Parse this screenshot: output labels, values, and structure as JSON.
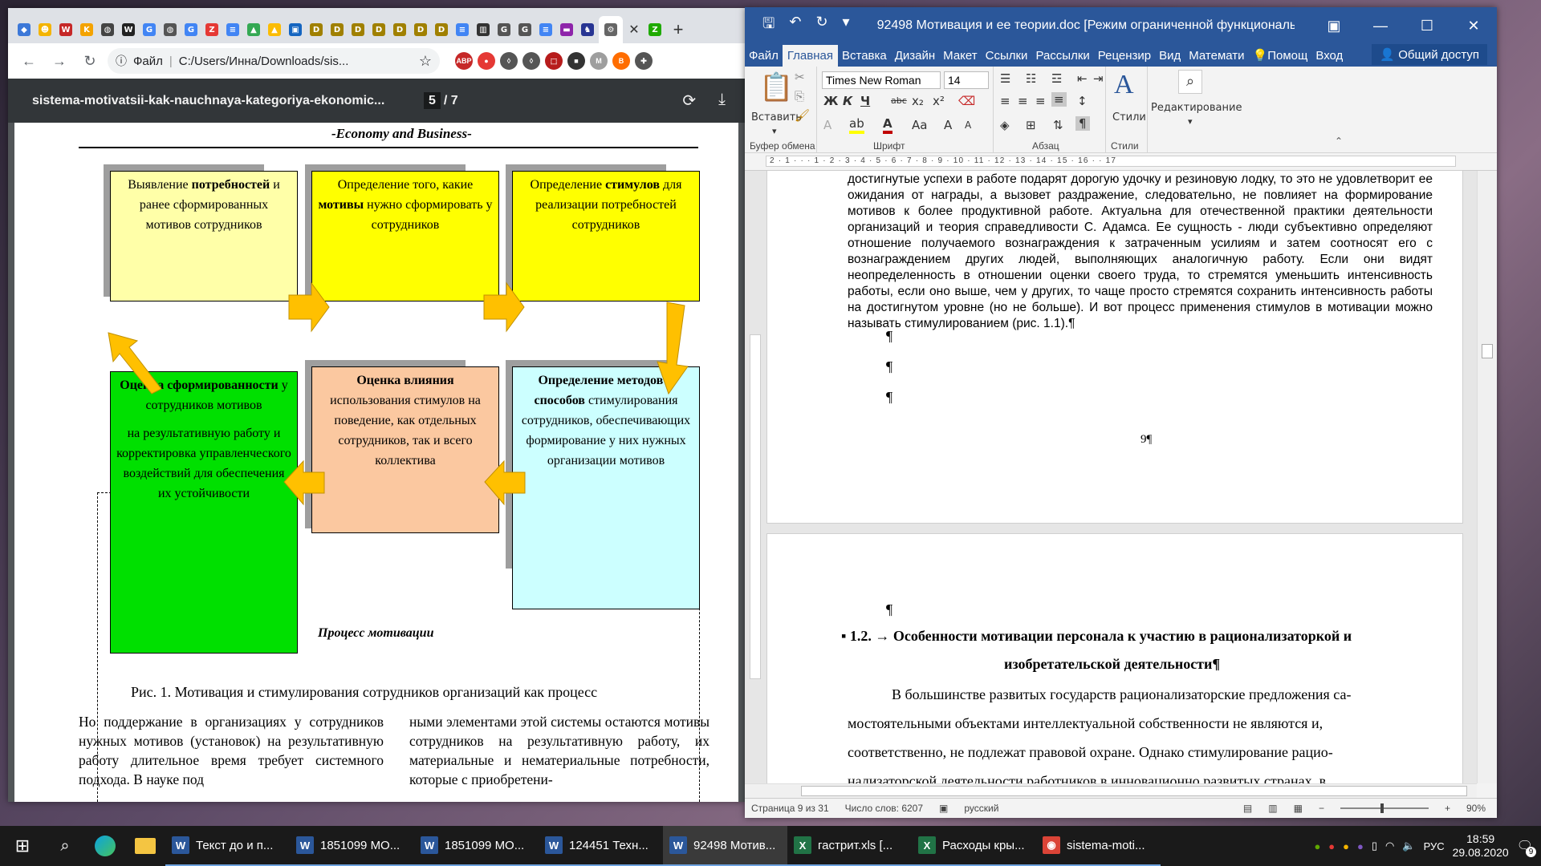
{
  "chrome": {
    "tabs": [
      {
        "icon": "diamond-icon",
        "color": "#3c78d8",
        "glyph": "◆"
      },
      {
        "icon": "face-icon",
        "color": "#f4b400",
        "glyph": "☻"
      },
      {
        "icon": "w-red-icon",
        "color": "#c62828",
        "glyph": "W"
      },
      {
        "icon": "k-icon",
        "color": "#f4a300",
        "glyph": "K"
      },
      {
        "icon": "globe-icon",
        "color": "#444",
        "glyph": "◍"
      },
      {
        "icon": "w-icon",
        "color": "#222",
        "glyph": "W"
      },
      {
        "icon": "g-icon",
        "color": "#4285f4",
        "glyph": "G"
      },
      {
        "icon": "globe2-icon",
        "color": "#555",
        "glyph": "◍"
      },
      {
        "icon": "g2-icon",
        "color": "#4285f4",
        "glyph": "G"
      },
      {
        "icon": "za-icon",
        "color": "#e53935",
        "glyph": "Z"
      },
      {
        "icon": "doc-icon",
        "color": "#4285f4",
        "glyph": "≡"
      },
      {
        "icon": "drive-icon",
        "color": "#34a853",
        "glyph": "▲"
      },
      {
        "icon": "drive2-icon",
        "color": "#fbbc04",
        "glyph": "▲"
      },
      {
        "icon": "photo-icon",
        "color": "#1565c0",
        "glyph": "▣"
      },
      {
        "icon": "d1-icon",
        "color": "#a08000",
        "glyph": "D"
      },
      {
        "icon": "d2-icon",
        "color": "#a08000",
        "glyph": "D"
      },
      {
        "icon": "d3-icon",
        "color": "#a08000",
        "glyph": "D"
      },
      {
        "icon": "d4-icon",
        "color": "#a08000",
        "glyph": "D"
      },
      {
        "icon": "d5-icon",
        "color": "#a08000",
        "glyph": "D"
      },
      {
        "icon": "d6-icon",
        "color": "#a08000",
        "glyph": "D"
      },
      {
        "icon": "d7-icon",
        "color": "#a08000",
        "glyph": "D"
      },
      {
        "icon": "doc2-icon",
        "color": "#4285f4",
        "glyph": "≡"
      },
      {
        "icon": "reader-icon",
        "color": "#333",
        "glyph": "▥"
      },
      {
        "icon": "gc-icon",
        "color": "#555",
        "glyph": "G"
      },
      {
        "icon": "gc2-icon",
        "color": "#555",
        "glyph": "G"
      },
      {
        "icon": "doc3-icon",
        "color": "#4285f4",
        "glyph": "≡"
      },
      {
        "icon": "flag-icon",
        "color": "#8e24aa",
        "glyph": "▬"
      },
      {
        "icon": "person-icon",
        "color": "#283593",
        "glyph": "♞"
      }
    ],
    "active_tab_icon": "gear-icon",
    "url_label": "Файл",
    "url": "C:/Users/Инна/Downloads/sis...",
    "extensions": [
      {
        "name": "abp-icon",
        "label": "ABP",
        "color": "#c62828"
      },
      {
        "name": "shield-red-icon",
        "label": "●",
        "color": "#e53935"
      },
      {
        "name": "shield-outline-icon",
        "label": "◊",
        "color": "#555"
      },
      {
        "name": "shield-outline2-icon",
        "label": "◊",
        "color": "#555"
      },
      {
        "name": "pdf-icon",
        "label": "⬚",
        "color": "#b71c1c"
      },
      {
        "name": "cube-icon",
        "label": "■",
        "color": "#333"
      },
      {
        "name": "m-icon",
        "label": "M",
        "color": "#9e9e9e"
      },
      {
        "name": "b-icon",
        "label": "B",
        "color": "#ff6d00"
      },
      {
        "name": "puzzle-icon",
        "label": "✚",
        "color": "#555"
      }
    ]
  },
  "pdf": {
    "title": "sistema-motivatsii-kak-nauchnaya-kategoriya-ekonomic...",
    "current_page": "5",
    "page_total": "/ 7",
    "header": "-Economy and Business-",
    "boxes": {
      "b1_pre": "Выявление ",
      "b1_bold": "потребностей",
      "b1_post": " и ранее сформированных мотивов сотрудников",
      "b2_pre": "Определение того, какие ",
      "b2_bold": "мотивы",
      "b2_post": " нужно сформировать у сотрудников",
      "b3_pre": "Определение ",
      "b3_bold": "стимулов",
      "b3_post": " для реализации потребностей сотрудников",
      "b4_bold": "Оценка сформированности",
      "b4_mid": " у сотрудников мотивов",
      "b4_post": "на результативную работу и корректировка управленческого воздействий для обеспечения их устойчивости",
      "b5_bold": "Оценка влияния",
      "b5_post": " использования стимулов на поведение, как отдельных сотрудников, так и всего коллектива",
      "b6_bold": "Определение методов и способов",
      "b6_post": " стимулирования сотрудников, обеспечивающих формирование у них нужных организации мотивов"
    },
    "process_label": "Процесс мотивации",
    "caption": "Рис. 1. Мотивация и стимулирования сотрудников организаций как процесс",
    "col1": "Но поддержание в организациях у сотрудников нужных мотивов (установок) на результативную работу длительное время требует системного подхода. В науке под",
    "col2": "ными элементами этой системы остаются мотивы сотрудников на результативную работу, их материальные и нематериальные потребности, которые с приобретени-"
  },
  "word": {
    "title": "92498 Мотивация и ее теории.doc [Режим ограниченной функциональ...",
    "menu": [
      "Файл",
      "Главная",
      "Вставка",
      "Дизайн",
      "Макет",
      "Ссылки",
      "Рассылки",
      "Рецензир",
      "Вид",
      "Математи",
      "Помощ",
      "Вход"
    ],
    "share_label": "Общий доступ",
    "ribbon": {
      "paste_label": "Вставить",
      "clipboard_label": "Буфер обмена",
      "font_name": "Times New Roman",
      "font_size": "14",
      "font_label": "Шрифт",
      "paragraph_label": "Абзац",
      "styles_btn": "Стили",
      "styles_label": "Стили",
      "editing_label": "Редактирование"
    },
    "ruler_text": "2 · 1 · · · 1 · 2 · 3 · 4 · 5 · 6 · 7 · 8 · 9 · 10 · 11 · 12 · 13 · 14 · 15 · 16 · · 17",
    "page1_text": "достигнутые успехи в работе подарят дорогую удочку и резиновую лодку, то это не удовлетворит ее ожидания от награды, а вызовет раздражение, следовательно, не повлияет на формирование мотивов к более продуктивной работе. Актуальна для отечественной практики деятельности организаций и теория справедливости С. Адамса. Ее сущность - люди субъективно определяют отношение получаемого вознаграждения к затраченным усилиям и затем соотносят его с вознаграждением других людей, выполняющих аналогичную работу. Если они видят неопределенность в отношении оценки своего труда, то стремятся уменьшить интенсивность работы, если оно выше, чем у других, то чаще просто стремятся сохранить интенсивность работы на достигнутом уровне (но не больше). И вот процесс применения стимулов в мотивации можно называть стимулированием (рис. 1.1).¶",
    "pilcrow": "¶",
    "page_number": "9¶",
    "heading_line1": "1.2. → Особенности мотивации персонала к участию в рационализаторкой и",
    "heading_line2": "изобретательской деятельности¶",
    "page2_lines": [
      "В большинстве развитых государств рационализаторские предложения са-",
      "мостоятельными объектами интеллектуальной собственности не являются и,",
      "соответственно, не подлежат правовой охране. Однако стимулирование рацио-",
      "нализаторской деятельности работников в инновационно развитых странах, в"
    ],
    "status": {
      "page": "Страница 9 из 31",
      "words": "Число слов: 6207",
      "lang": "русский",
      "zoom": "90%"
    }
  },
  "taskbar": {
    "apps": [
      {
        "icon": "word-icon",
        "label": "Текст до и п...",
        "color": "#2b579a",
        "glyph": "W"
      },
      {
        "icon": "word-icon",
        "label": "1851099 МО...",
        "color": "#2b579a",
        "glyph": "W"
      },
      {
        "icon": "word-icon",
        "label": "1851099 МО...",
        "color": "#2b579a",
        "glyph": "W"
      },
      {
        "icon": "word-icon",
        "label": "124451 Техн...",
        "color": "#2b579a",
        "glyph": "W"
      },
      {
        "icon": "word-icon",
        "label": "92498 Мотив...",
        "color": "#2b579a",
        "glyph": "W"
      },
      {
        "icon": "excel-icon",
        "label": "гастрит.xls [...",
        "color": "#217346",
        "glyph": "X"
      },
      {
        "icon": "excel-icon",
        "label": "Расходы кры...",
        "color": "#217346",
        "glyph": "X"
      },
      {
        "icon": "chrome-icon",
        "label": "sistema-moti...",
        "color": "#db4437",
        "glyph": "◉"
      }
    ],
    "lang": "РУС",
    "time": "18:59",
    "date": "29.08.2020",
    "notif_count": "9"
  }
}
